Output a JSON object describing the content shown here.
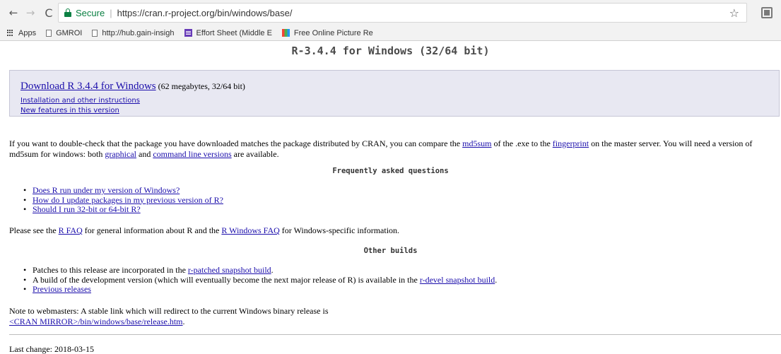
{
  "browser": {
    "back_icon": "←",
    "forward_icon": "→",
    "reload_icon": "C",
    "secure_label": "Secure",
    "url": "https://cran.r-project.org/bin/windows/base/",
    "star_icon": "☆",
    "bookmarks": [
      {
        "label": "Apps",
        "icon": "apps-grid"
      },
      {
        "label": "GMROI",
        "icon": "page"
      },
      {
        "label": "http://hub.gain-insigh",
        "icon": "page"
      },
      {
        "label": "Effort Sheet (Middle E",
        "icon": "sheet"
      },
      {
        "label": "Free Online Picture Re",
        "icon": "picture"
      }
    ]
  },
  "page": {
    "title": "R-3.4.4 for Windows (32/64 bit)",
    "download": {
      "link": "Download R 3.4.4 for Windows",
      "size": " (62 megabytes, 32/64 bit)",
      "install_link": "Installation and other instructions",
      "features_link": "New features in this version"
    },
    "md5": {
      "t1": "If you want to double-check that the package you have downloaded matches the package distributed by CRAN, you can compare the ",
      "link1": "md5sum",
      "t2": " of the .exe to the ",
      "link2": "fingerprint",
      "t3": " on the master server. You will need a version of md5sum for windows: both ",
      "link3": "graphical",
      "t4": " and ",
      "link4": "command line versions",
      "t5": " are available."
    },
    "faq": {
      "heading": "Frequently asked questions",
      "items": [
        "Does R run under my version of Windows?",
        "How do I update packages in my previous version of R?",
        "Should I run 32-bit or 64-bit R?"
      ]
    },
    "see": {
      "t1": "Please see the ",
      "link1": "R FAQ",
      "t2": " for general information about R and the ",
      "link2": "R Windows FAQ",
      "t3": " for Windows-specific information."
    },
    "other": {
      "heading": "Other builds",
      "item1_text": "Patches to this release are incorporated in the ",
      "item1_link": "r-patched snapshot build",
      "item1_end": ".",
      "item2_text": "A build of the development version (which will eventually become the next major release of R) is available in the ",
      "item2_link": "r-devel snapshot build",
      "item2_end": ".",
      "item3_link": "Previous releases"
    },
    "note": {
      "text": "Note to webmasters: A stable link which will redirect to the current Windows binary release is",
      "link": "<CRAN MIRROR>/bin/windows/base/release.htm",
      "end": "."
    },
    "last_change": "Last change: 2018-03-15"
  }
}
